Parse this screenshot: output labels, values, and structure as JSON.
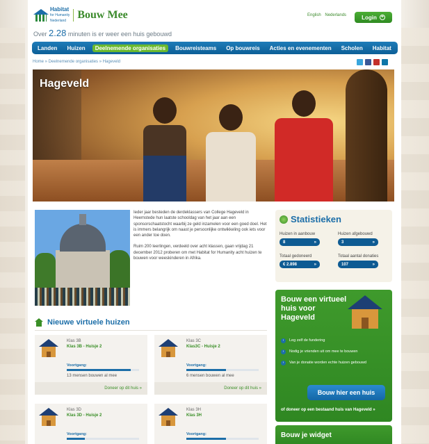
{
  "header": {
    "logo_brand": "Habitat",
    "logo_brand_sub": "for Humanity",
    "logo_country": "Nederland",
    "site_title": "Bouw Mee",
    "tagline_before": "Over",
    "tagline_number": "2.28",
    "tagline_after": "minuten is er weer een huis gebouwd",
    "lang_en": "English",
    "lang_nl": "Nederlands",
    "login_label": "Login"
  },
  "nav": {
    "items": [
      "Landen",
      "Huizen",
      "Deelnemende organisaties",
      "Bouwreisteams",
      "Op bouwreis",
      "Acties en evenementen",
      "Scholen",
      "Habitat"
    ],
    "active_index": 2
  },
  "breadcrumb": "Home » Deelnemende organisaties » Hageveld",
  "social": {
    "icons": [
      "twitter-icon",
      "facebook-icon",
      "youtube-icon",
      "linkedin-icon"
    ],
    "colors": [
      "#3aa6dd",
      "#3b5998",
      "#c4302b",
      "#0e76a8"
    ]
  },
  "hero": {
    "title": "Hageveld"
  },
  "intro": {
    "p1": "Ieder jaar besteden de derdeklassers van College Hageveld in Heemstede hun laatste schooldag van het jaar aan een sponsorschaatstocht waarbij ze geld inzamelen voor een goed doel. Het is immers belangrijk om naast je persoonlijke ontwikkeling ook iets voor een ander toe doen.",
    "p2": "Ruim 200 leerlingen, verdeeld over acht klassen, gaan vrijdag 21 december 2012 proberen om met Habitat for Humanity acht huizen te bouwen voor weeskinderen in Afrika."
  },
  "stats": {
    "title": "Statistieken",
    "items": [
      {
        "label": "Huizen in aanbouw",
        "value": "8"
      },
      {
        "label": "Huizen afgebouwd",
        "value": "3"
      },
      {
        "label": "Totaal gedoneerd",
        "value": "€ 2.898"
      },
      {
        "label": "Totaal aantal donaties",
        "value": "107"
      }
    ]
  },
  "cta": {
    "title": "Bouw een virtueel huis voor Hageveld",
    "steps": [
      "Leg zelf de fundering",
      "Nodig je vrienden uit om mee te bouwen",
      "Van je donatie worden echte huizen gebouwd"
    ],
    "button": "Bouw hier een huis",
    "footer": "of doneer op een bestaand huis van Hageveld »"
  },
  "widget": {
    "title": "Bouw je widget"
  },
  "new_houses": {
    "title": "Nieuwe virtuele huizen",
    "progress_label": "Voortgang:",
    "donate_label": "Doneer op dit huis »",
    "cards": [
      {
        "klas": "Klas 3B",
        "name": "Klas 3B - Huisje 2",
        "progress": 0.88,
        "builders": "13 mensen bouwen al mee"
      },
      {
        "klas": "Klas 3C",
        "name": "Klas3C - Huisje 2",
        "progress": 0.55,
        "builders": "6 mensen bouwen al mee"
      },
      {
        "klas": "Klas 3D",
        "name": "Klas 3D - Huisje 2",
        "progress": 0.25,
        "builders": ""
      },
      {
        "klas": "Klas 3H",
        "name": "Klas 3H",
        "progress": 0.55,
        "builders": ""
      }
    ]
  }
}
